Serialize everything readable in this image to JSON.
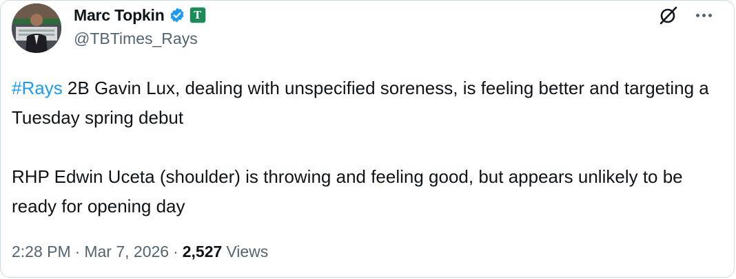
{
  "author": {
    "display_name": "Marc Topkin",
    "handle": "@TBTimes_Rays",
    "affiliation_badge": "T",
    "verified_color": "#1d9bf0"
  },
  "tweet": {
    "hashtag": "#Rays",
    "line1_rest": " 2B Gavin Lux, dealing with unspecified soreness, is feeling better and targeting a Tuesday spring debut",
    "paragraph2": "RHP Edwin Uceta (shoulder) is throwing and feeling good, but appears unlikely to be ready for opening day"
  },
  "meta": {
    "time": "2:28 PM",
    "separator": "·",
    "date": "Mar 7, 2026",
    "views_count": "2,527",
    "views_label": "Views"
  },
  "icons": {
    "grok": "grok-icon",
    "more": "more-options-icon",
    "verified": "verified-badge-icon"
  },
  "colors": {
    "link": "#1d9bf0",
    "secondary_text": "#536471",
    "primary_text": "#0f1419"
  }
}
